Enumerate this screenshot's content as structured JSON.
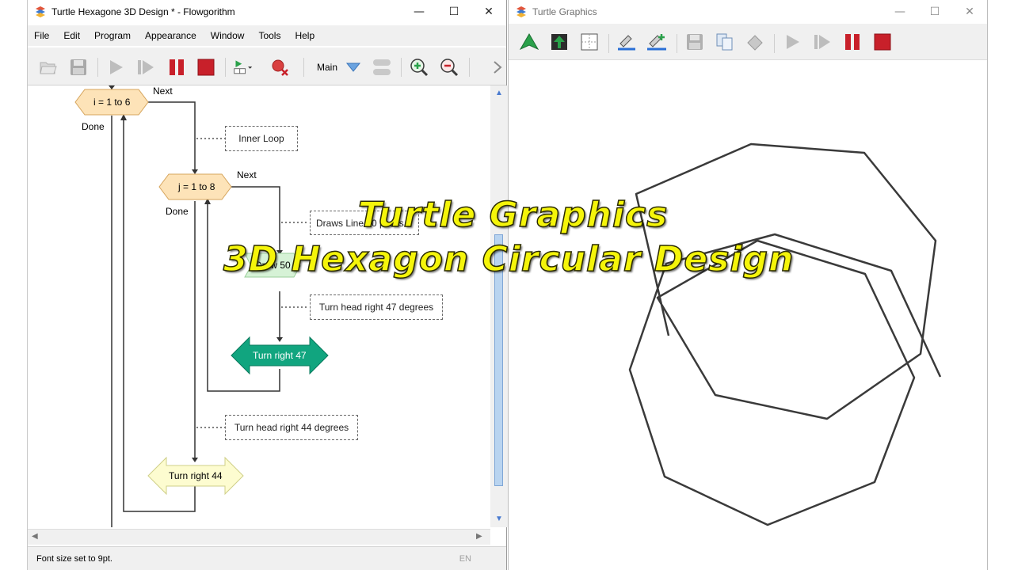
{
  "left_window": {
    "title": "Turtle Hexagone 3D Design * - Flowgorithm",
    "icon": "flowgorithm-app-icon",
    "controls": {
      "minimize": "—",
      "maximize": "☐",
      "close": "✕"
    },
    "menu": [
      "File",
      "Edit",
      "Program",
      "Appearance",
      "Window",
      "Tools",
      "Help"
    ],
    "toolbar": {
      "function_select": "Main",
      "buttons": [
        "open-icon",
        "save-icon",
        "run-icon",
        "step-icon",
        "pause-icon",
        "stop-icon",
        "add-watch-icon",
        "clear-breakpoint-icon",
        "function-dropdown-icon",
        "layout-icon",
        "zoom-in-icon",
        "zoom-out-icon",
        "more-icon"
      ]
    },
    "flowchart": {
      "outer_loop": {
        "text": "i = 1 to 6",
        "next": "Next",
        "done": "Done"
      },
      "inner_comment": "Inner Loop",
      "inner_loop": {
        "text": "j = 1 to 8",
        "next": "Next",
        "done": "Done"
      },
      "draw_comment": "Draws Line 50 pixels",
      "draw_block": "Draw 50",
      "turn47_comment": "Turn head right 47 degrees",
      "turn47_block": "Turn right 47",
      "turn44_comment": "Turn head right 44 degrees",
      "turn44_block": "Turn right 44"
    },
    "status": {
      "message": "Font size set to 9pt.",
      "lang": "EN"
    }
  },
  "right_window": {
    "title": "Turtle Graphics",
    "icon": "flowgorithm-app-icon",
    "controls": {
      "minimize": "—",
      "maximize": "☐",
      "close": "✕"
    },
    "toolbar": [
      "turtle-icon",
      "pen-up-icon",
      "grid-icon",
      "line-width-icon",
      "line-color-icon",
      "save-icon",
      "copy-icon",
      "erase-icon",
      "run-icon",
      "step-icon",
      "pause-icon",
      "stop-icon"
    ]
  },
  "overlay": {
    "line1": "Turtle Graphics",
    "line2": "3D Hexagon Circular Design"
  },
  "colors": {
    "overlay_text": "#f5f50a",
    "loop_fill": "#fde3b8",
    "turn47_fill": "#11a57f",
    "turn44_fill": "#fdfcd0",
    "draw_fill": "#d6f2d6",
    "pause": "#c8202a",
    "stop": "#c8202a",
    "turtle": "#2aa14a"
  }
}
